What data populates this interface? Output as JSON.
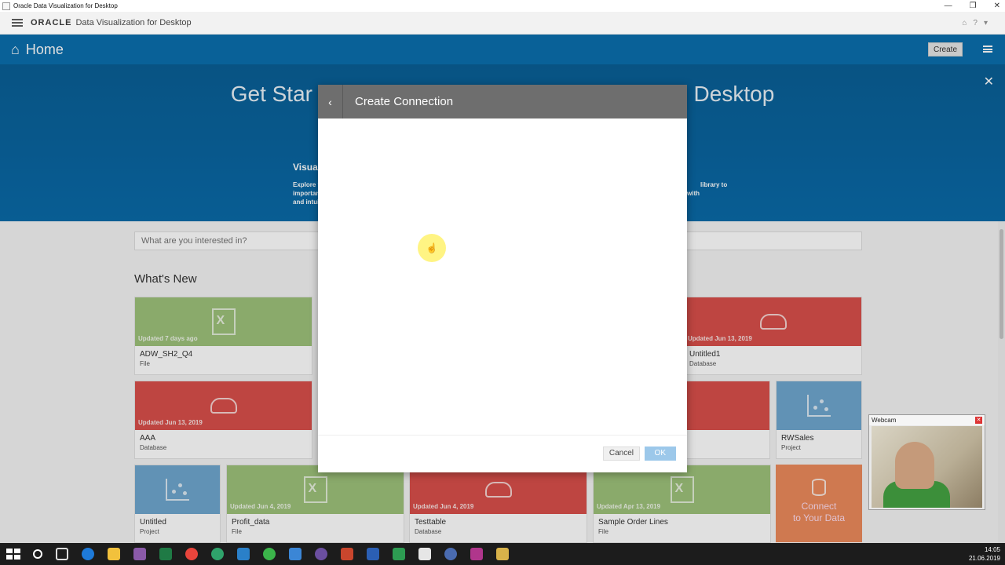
{
  "window": {
    "title": "Oracle Data Visualization for Desktop"
  },
  "header": {
    "logo": "ORACLE",
    "app_name": "Data Visualization for Desktop"
  },
  "homebar": {
    "title": "Home",
    "create_label": "Create"
  },
  "hero": {
    "title_left": "Get Star",
    "title_right": "Desktop",
    "sub_left": "Visua",
    "desc_left_1": "Explore y",
    "desc_left_2": "importan",
    "desc_left_3": "and intui",
    "desc_right_1": "library to",
    "desc_right_2": "with"
  },
  "search": {
    "placeholder": "What are you interested in?"
  },
  "whats_new": {
    "title": "What's New",
    "tiles": [
      {
        "updated": "Updated 7 days ago",
        "name": "ADW_SH2_Q4",
        "type": "File",
        "color": "#9ec27a",
        "icon": "excel-file-icon"
      },
      {
        "updated": "Updated Jun 13, 2019",
        "name": "Untitled1",
        "type": "Database",
        "color": "#d94f4a",
        "icon": "cloud-database-icon"
      },
      {
        "updated": "Updated Jun 13, 2019",
        "name": "AAA",
        "type": "Database",
        "color": "#d94f4a",
        "icon": "cloud-database-icon"
      },
      {
        "updated": "",
        "name": "RWSales",
        "type": "Project",
        "color": "#6fa7cf",
        "icon": "scatter-chart-icon"
      },
      {
        "updated": "",
        "name": "Untitled",
        "type": "Project",
        "color": "#6fa7cf",
        "icon": "scatter-chart-icon"
      },
      {
        "updated": "Updated Jun 4, 2019",
        "name": "Profit_data",
        "type": "File",
        "color": "#9ec27a",
        "icon": "excel-file-icon"
      },
      {
        "updated": "Updated Jun 4, 2019",
        "name": "Testtable",
        "type": "Database",
        "color": "#d94f4a",
        "icon": "cloud-database-icon"
      },
      {
        "updated": "Updated Apr 13, 2019",
        "name": "Sample Order Lines",
        "type": "File",
        "color": "#9ec27a",
        "icon": "excel-file-icon"
      }
    ],
    "connect_label_1": "Connect",
    "connect_label_2": "to Your Data"
  },
  "dialog": {
    "title": "Create Connection",
    "cancel_label": "Cancel",
    "ok_label": "OK"
  },
  "webcam": {
    "title": "Webcam"
  },
  "taskbar": {
    "time": "14:05",
    "date": "21.06.2019"
  }
}
